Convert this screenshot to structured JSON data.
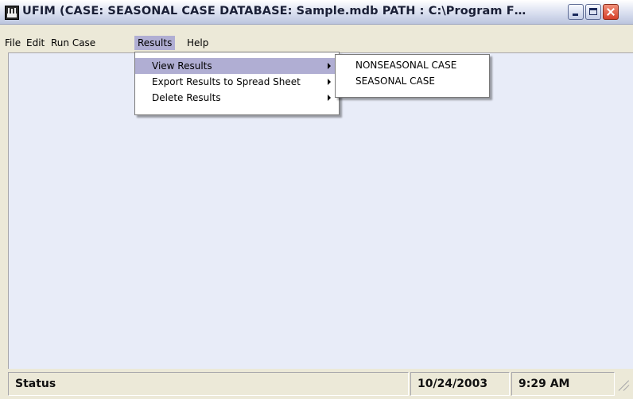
{
  "window": {
    "title": "UFIM (CASE: SEASONAL CASE    DATABASE: Sample.mdb    PATH : C:\\Program F…"
  },
  "menubar": {
    "items": [
      {
        "label": "File"
      },
      {
        "label": "Edit"
      },
      {
        "label": "Run Case"
      },
      {
        "label": "Results"
      },
      {
        "label": "Help"
      }
    ]
  },
  "results_menu": {
    "items": [
      {
        "label": "View Results"
      },
      {
        "label": "Export Results to Spread Sheet"
      },
      {
        "label": "Delete Results"
      }
    ]
  },
  "view_results_submenu": {
    "items": [
      {
        "label": "NONSEASONAL CASE"
      },
      {
        "label": "SEASONAL CASE"
      }
    ]
  },
  "statusbar": {
    "status": "Status",
    "date": "10/24/2003",
    "time": "9:29 AM"
  }
}
